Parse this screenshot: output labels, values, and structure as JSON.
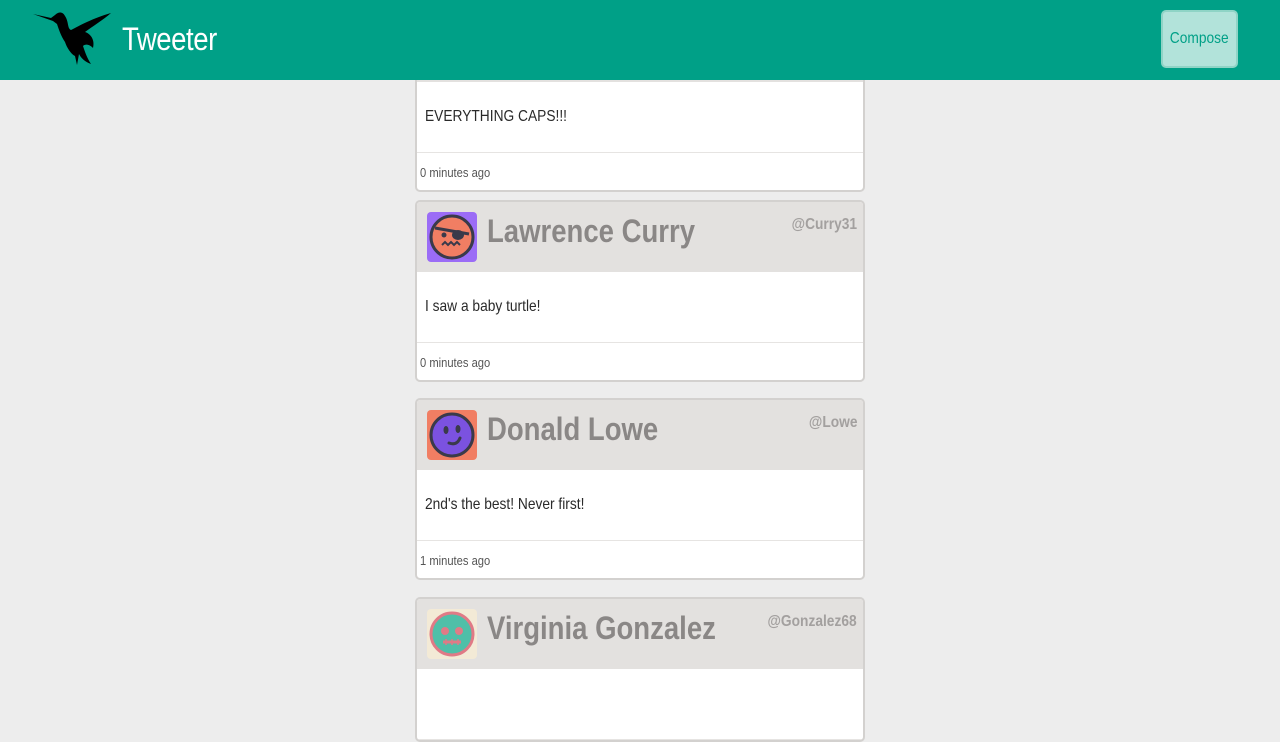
{
  "app": {
    "title": "Tweeter"
  },
  "header": {
    "compose_label": "Compose"
  },
  "tweets": [
    {
      "name": "",
      "handle": "",
      "text": "EVERYTHING CAPS!!!",
      "time": "0 minutes ago",
      "avatar_bg": "#ffffff"
    },
    {
      "name": "Lawrence Curry",
      "handle": "@Curry31",
      "text": "I saw a baby turtle!",
      "time": "0 minutes ago",
      "avatar_bg": "#9b6cf6"
    },
    {
      "name": "Donald Lowe",
      "handle": "@Lowe",
      "text": "2nd's the best! Never first!",
      "time": "1 minutes ago",
      "avatar_bg": "#f17e63"
    },
    {
      "name": "Virginia Gonzalez",
      "handle": "@Gonzalez68",
      "text": "",
      "time": "",
      "avatar_bg": "#f3ead6"
    }
  ],
  "colors": {
    "brand": "#00a087",
    "page_bg": "#ededed",
    "header_bg": "#e3e1df"
  }
}
